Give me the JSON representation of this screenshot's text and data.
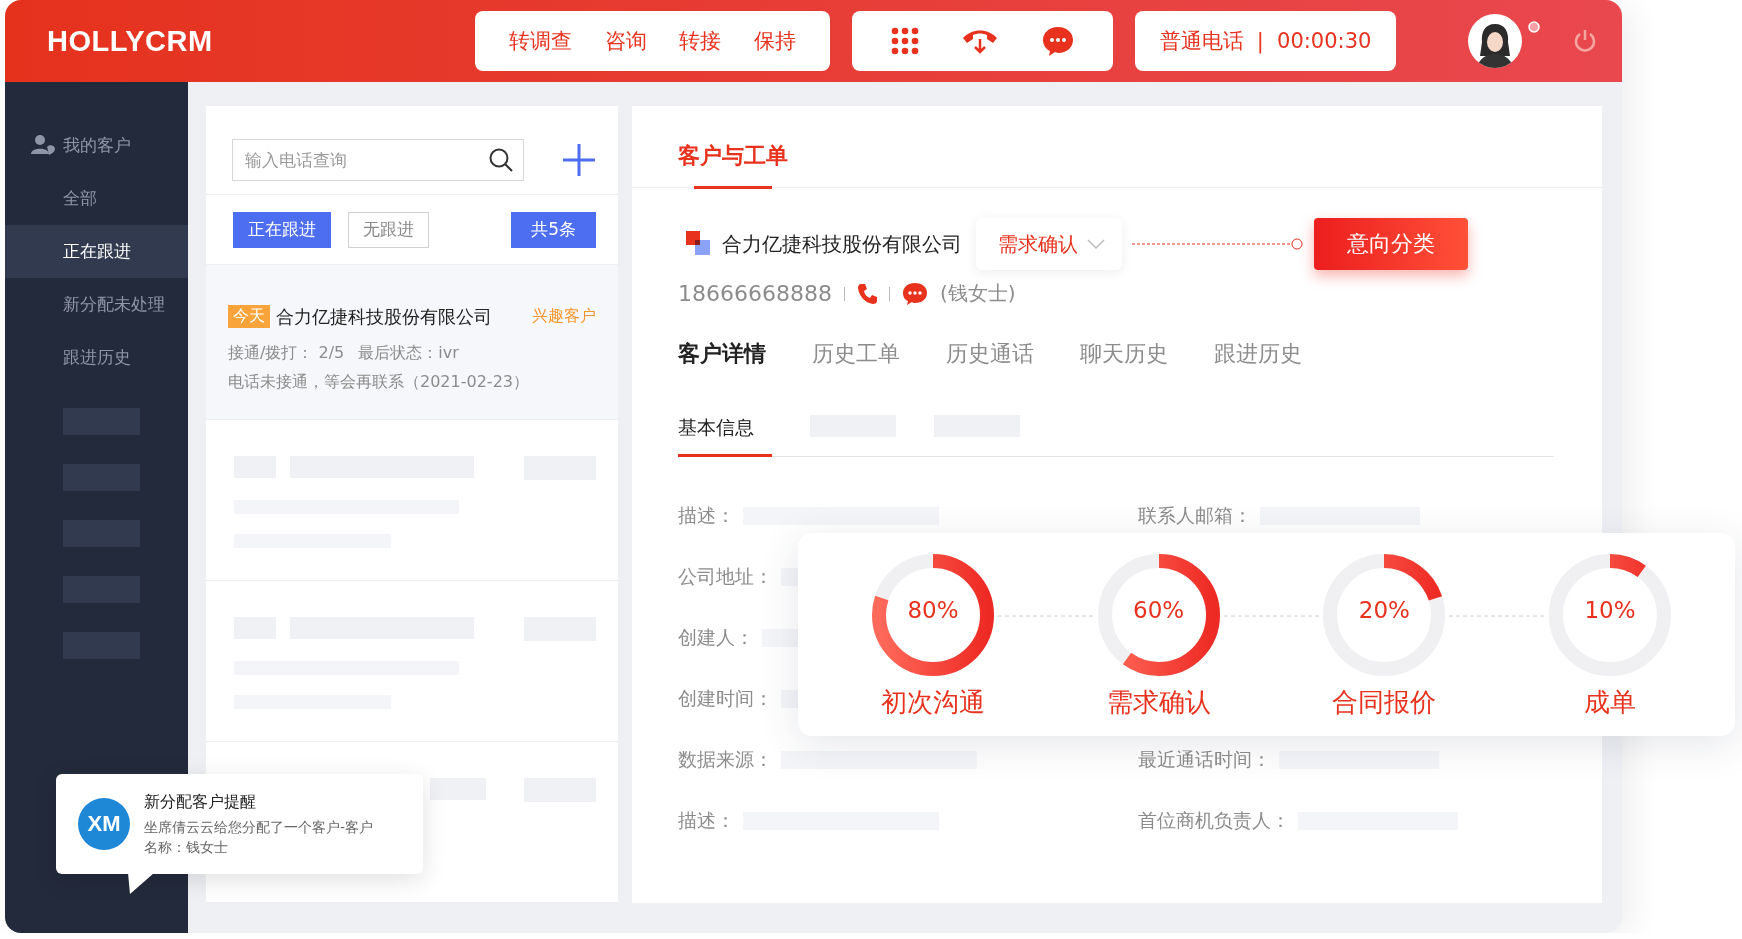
{
  "app": {
    "logo": "HOLLYCRM"
  },
  "call_actions": [
    {
      "label": "转调查"
    },
    {
      "label": "咨询"
    },
    {
      "label": "转接"
    },
    {
      "label": "保持"
    }
  ],
  "call_status": {
    "type": "普通电话",
    "separator": "|",
    "timer": "00:00:30"
  },
  "sidebar": {
    "header": "我的客户",
    "items": [
      {
        "label": "全部",
        "selected": false
      },
      {
        "label": "正在跟进",
        "selected": true
      },
      {
        "label": "新分配未处理",
        "selected": false
      },
      {
        "label": "跟进历史",
        "selected": false
      }
    ]
  },
  "list": {
    "search": {
      "placeholder": "输入电话查询"
    },
    "filters": [
      {
        "label": "正在跟进",
        "selected": true
      },
      {
        "label": "无跟进",
        "selected": false
      }
    ],
    "count": "共5条",
    "items": [
      {
        "tag": "今天",
        "name": "合力亿捷科技股份有限公司",
        "category": "兴趣客户",
        "stats": "接通/拨打：  2/5",
        "last_state": "最后状态：ivr",
        "note": "电话未接通，等会再联系（2021-02-23）"
      }
    ]
  },
  "detail": {
    "title": "客户与工单",
    "company": "合力亿捷科技股份有限公司",
    "stage": "需求确认",
    "classify_button": "意向分类",
    "phone": "18666668888",
    "contact": "(钱女士)",
    "tabs": [
      {
        "label": "客户详情",
        "selected": true
      },
      {
        "label": "历史工单",
        "selected": false
      },
      {
        "label": "历史通话",
        "selected": false
      },
      {
        "label": "聊天历史",
        "selected": false
      },
      {
        "label": "跟进历史",
        "selected": false
      }
    ],
    "subtabs": [
      {
        "label": "基本信息",
        "selected": true
      }
    ],
    "fields": [
      {
        "left": "描述：",
        "right": "联系人邮箱："
      },
      {
        "left": "公司地址："
      },
      {
        "left": "创建人："
      },
      {
        "left": "创建时间："
      },
      {
        "left": "数据来源：",
        "right": "最近通话时间："
      },
      {
        "left": "描述：",
        "right": "首位商机负责人："
      }
    ]
  },
  "stages": [
    {
      "percent": "80%",
      "label": "初次沟通",
      "level": 0.8
    },
    {
      "percent": "60%",
      "label": "需求确认",
      "level": 0.6
    },
    {
      "percent": "20%",
      "label": "合同报价",
      "level": 0.2
    },
    {
      "percent": "10%",
      "label": "成单",
      "level": 0.1
    }
  ],
  "notification": {
    "avatar": "XM",
    "title": "新分配客户提醒",
    "body": "坐席倩云云给您分配了一个客户-客户名称：钱女士"
  }
}
